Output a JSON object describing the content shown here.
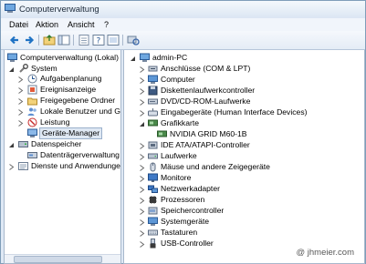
{
  "window": {
    "title": "Computerverwaltung"
  },
  "menu": [
    "Datei",
    "Aktion",
    "Ansicht",
    "?"
  ],
  "toolbar": {
    "buttons": [
      {
        "name": "back-arrow-icon"
      },
      {
        "name": "forward-arrow-icon"
      },
      {
        "name": "up-folder-icon"
      },
      {
        "name": "show-tree-icon"
      },
      {
        "name": "export-list-icon"
      },
      {
        "name": "help-icon"
      },
      {
        "name": "properties-icon"
      },
      {
        "name": "scan-hardware-icon"
      }
    ]
  },
  "left_tree": {
    "root": "Computerverwaltung (Lokal)",
    "system": {
      "label": "System",
      "children": [
        "Aufgabenplanung",
        "Ereignisanzeige",
        "Freigegebene Ordner",
        "Lokale Benutzer und Gr",
        "Leistung",
        "Geräte-Manager"
      ]
    },
    "storage": {
      "label": "Datenspeicher",
      "children": [
        "Datenträgerverwaltung"
      ]
    },
    "services": "Dienste und Anwendungen"
  },
  "device_tree": {
    "root": "admin-PC",
    "categories": [
      {
        "label": "Anschlüsse (COM & LPT)",
        "icon": "port-icon"
      },
      {
        "label": "Computer",
        "icon": "computer-icon"
      },
      {
        "label": "Diskettenlaufwerkcontroller",
        "icon": "floppy-controller-icon"
      },
      {
        "label": "DVD/CD-ROM-Laufwerke",
        "icon": "dvd-drive-icon"
      },
      {
        "label": "Eingabegeräte (Human Interface Devices)",
        "icon": "hid-icon"
      },
      {
        "label": "Grafikkarte",
        "icon": "display-adapter-icon",
        "expanded": true,
        "children": [
          "NVIDIA GRID M60-1B"
        ]
      },
      {
        "label": "IDE ATA/ATAPI-Controller",
        "icon": "ide-controller-icon"
      },
      {
        "label": "Laufwerke",
        "icon": "disk-drive-icon"
      },
      {
        "label": "Mäuse und andere Zeigegeräte",
        "icon": "mouse-icon"
      },
      {
        "label": "Monitore",
        "icon": "monitor-icon"
      },
      {
        "label": "Netzwerkadapter",
        "icon": "network-adapter-icon"
      },
      {
        "label": "Prozessoren",
        "icon": "processor-icon"
      },
      {
        "label": "Speichercontroller",
        "icon": "storage-controller-icon"
      },
      {
        "label": "Systemgeräte",
        "icon": "system-devices-icon"
      },
      {
        "label": "Tastaturen",
        "icon": "keyboard-icon"
      },
      {
        "label": "USB-Controller",
        "icon": "usb-icon"
      }
    ]
  },
  "watermark": "@ jhmeier.com",
  "colors": {
    "accent": "#316ac5",
    "selection": "#dfe8f3",
    "frame": "#dfe9f5"
  }
}
